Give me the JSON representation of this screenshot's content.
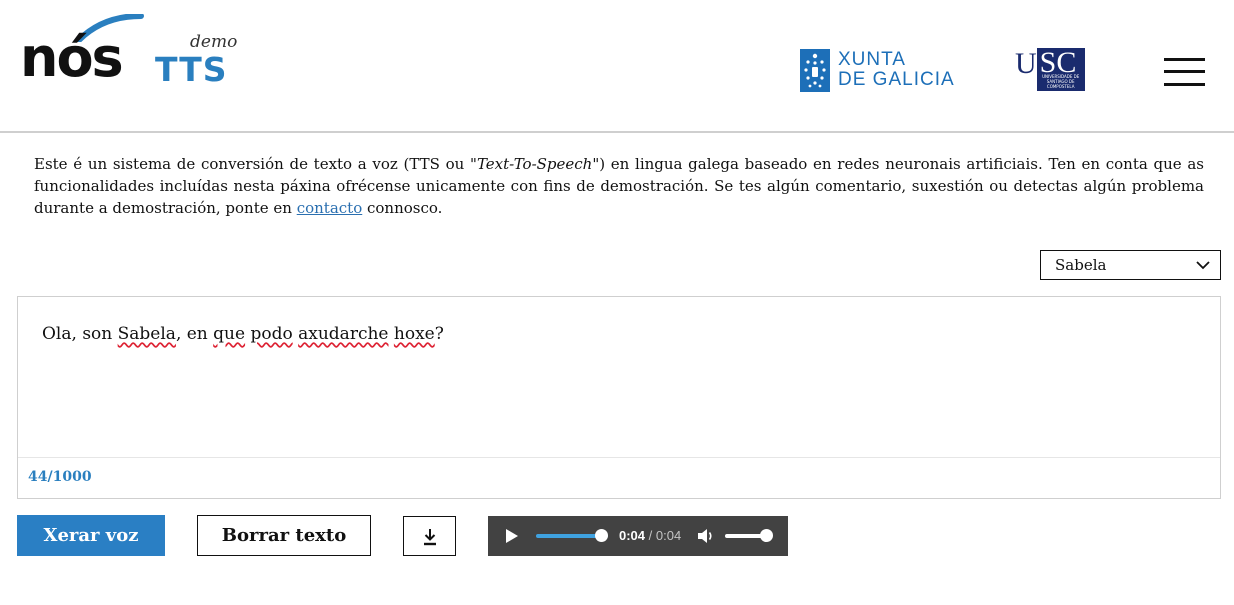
{
  "header": {
    "logo_main": "nós",
    "logo_demo": "demo",
    "logo_tts": "TTS",
    "xunta_line1": "XUNTA",
    "xunta_line2": "DE GALICIA",
    "usc_u": "U",
    "usc_sc": "SC",
    "usc_sub": "UNIVERSIDADE DE SANTIAGO DE COMPOSTELA",
    "menu_icon": "hamburger-menu-icon"
  },
  "description": {
    "part1": "Este é un sistema de conversión de texto a voz (TTS ou \"",
    "italic": "Text-To-Speech",
    "part2": "\") en lingua galega baseado en redes neuronais artificiais. Ten en conta que as funcionalidades incluídas nesta páxina ofrécense unicamente con fins de demostración. Se tes algún comentario, suxestión ou detectas algún problema durante a demostración, ponte en ",
    "link": "contacto",
    "part3": " connosco."
  },
  "voice_select": {
    "selected": "Sabela"
  },
  "editor": {
    "w1": "Ola, son ",
    "w2": "Sabela",
    "w3": ", en ",
    "w4": "que",
    "w5": " ",
    "w6": "podo",
    "w7": " ",
    "w8": "axudarche",
    "w9": " ",
    "w10": "hoxe",
    "w11": "?",
    "counter": "44/1000"
  },
  "buttons": {
    "generate": "Xerar voz",
    "clear": "Borrar texto",
    "download_icon": "download-icon"
  },
  "player": {
    "current": "0:04",
    "separator": " / ",
    "duration": "0:04",
    "progress": 1.0,
    "volume": 1.0
  },
  "colors": {
    "accent": "#2a7fc4",
    "xunta": "#1d6fb8",
    "usc": "#1a2b6e",
    "player_bg": "#424242"
  }
}
